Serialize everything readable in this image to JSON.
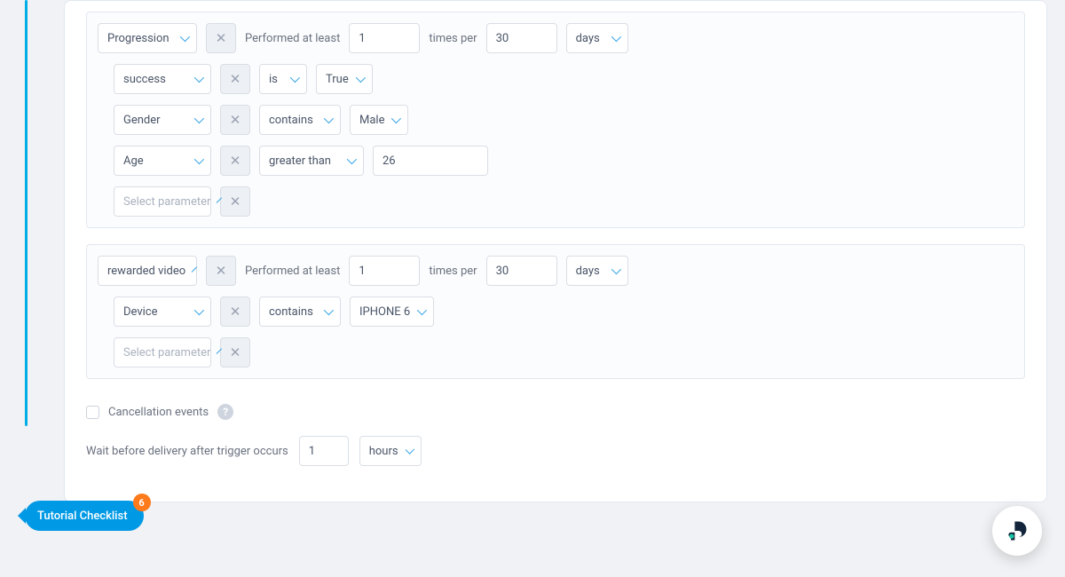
{
  "labels": {
    "performed_at_least": "Performed at least",
    "times_per": "times per",
    "select_parameter": "Select parameter",
    "cancellation_events": "Cancellation events",
    "wait_before": "Wait before delivery after trigger occurs"
  },
  "tutorial": {
    "label": "Tutorial Checklist",
    "badge": "6"
  },
  "rules": [
    {
      "event": "Progression",
      "at_least": "1",
      "window_count": "30",
      "window_unit": "days",
      "params": [
        {
          "name": "success",
          "op": "is",
          "value": "True",
          "value_is_select": true
        },
        {
          "name": "Gender",
          "op": "contains",
          "value": "Male",
          "value_is_select": true
        },
        {
          "name": "Age",
          "op": "greater than",
          "value": "26",
          "value_is_select": false
        }
      ]
    },
    {
      "event": "rewarded video",
      "at_least": "1",
      "window_count": "30",
      "window_unit": "days",
      "params": [
        {
          "name": "Device",
          "op": "contains",
          "value": "IPHONE 6",
          "value_is_select": true
        }
      ]
    }
  ],
  "wait": {
    "amount": "1",
    "unit": "hours"
  }
}
